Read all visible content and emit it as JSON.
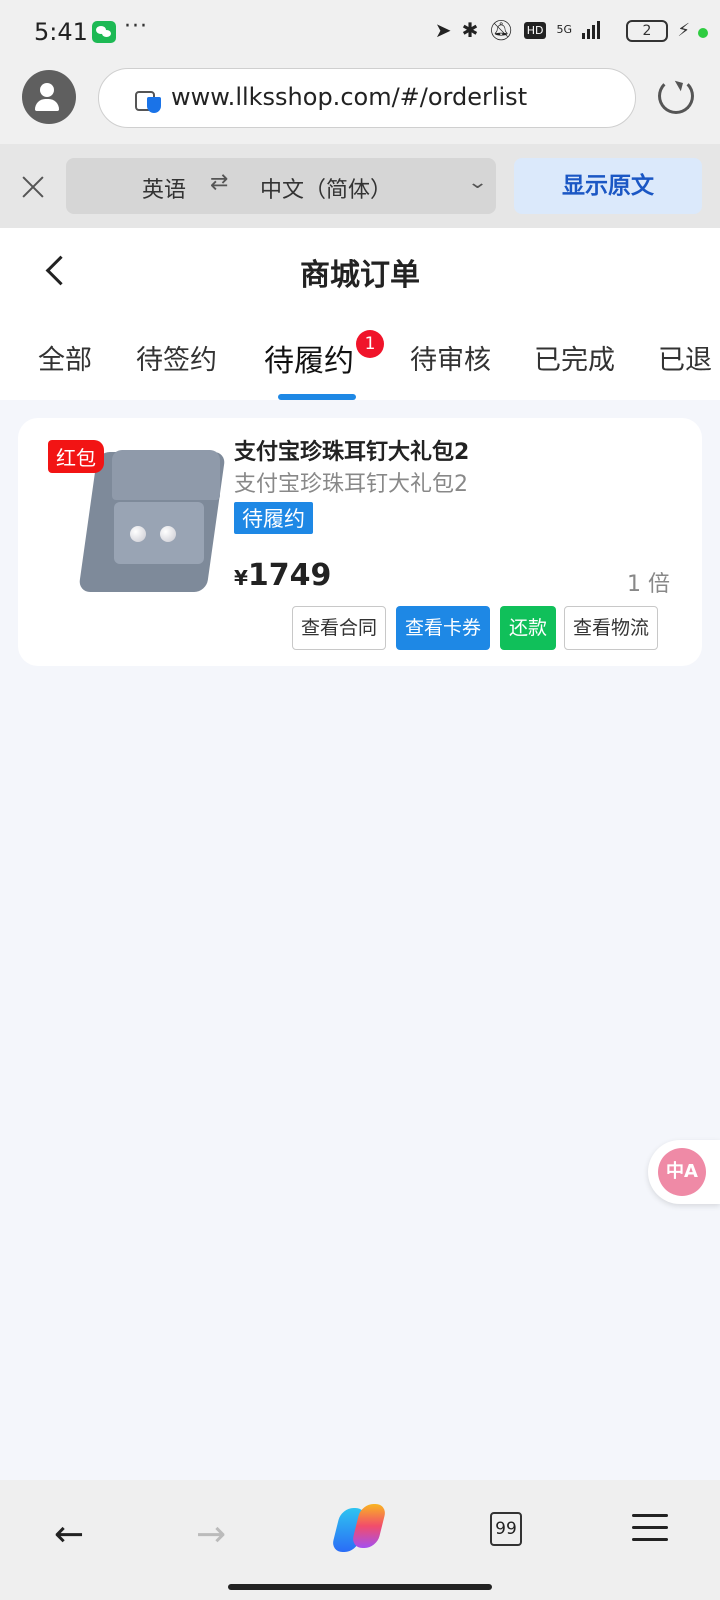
{
  "status_bar": {
    "time": "5:41",
    "more": "···",
    "network": "5G",
    "hd": "HD",
    "battery": "2"
  },
  "browser": {
    "url": "www.llksshop.com/#/orderlist"
  },
  "translate_bar": {
    "source_lang": "英语",
    "swap": "⇄",
    "target_lang": "中文（简体）",
    "show_original": "显示原文"
  },
  "page": {
    "title": "商城订单",
    "tabs": [
      {
        "label": "全部"
      },
      {
        "label": "待签约"
      },
      {
        "label": "待履约",
        "active": true,
        "badge": "1"
      },
      {
        "label": "待审核"
      },
      {
        "label": "已完成"
      },
      {
        "label": "已退"
      }
    ]
  },
  "order": {
    "tag": "红包",
    "name": "支付宝珍珠耳钉大礼包2",
    "subtitle": "支付宝珍珠耳钉大礼包2",
    "status": "待履约",
    "currency": "¥",
    "price": "1749",
    "multiplier": "1 倍",
    "buttons": {
      "contract": "查看合同",
      "voucher": "查看卡券",
      "repay": "还款",
      "logistics": "查看物流"
    }
  },
  "float_translate": {
    "label": "中A"
  },
  "bottom_nav": {
    "back": "←",
    "forward": "→",
    "tab_count": "99"
  },
  "colors": {
    "accent": "#1e88e5",
    "badge": "#f0142a",
    "repay": "#10c05a",
    "red_tag": "#f21414"
  }
}
